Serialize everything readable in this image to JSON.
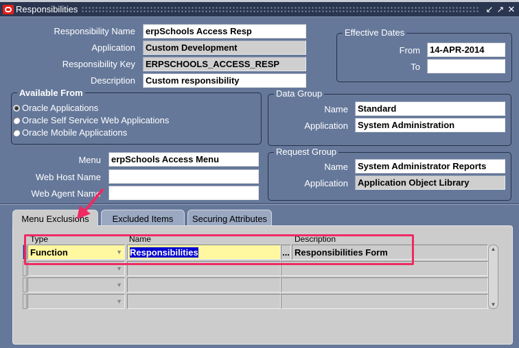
{
  "window": {
    "title": "Responsibilities",
    "controls": [
      "minimize-icon",
      "maximize-icon",
      "close-icon"
    ]
  },
  "header": {
    "responsibility_name": {
      "label": "Responsibility Name",
      "value": "erpSchools Access Resp"
    },
    "application": {
      "label": "Application",
      "value": "Custom Development"
    },
    "responsibility_key": {
      "label": "Responsibility Key",
      "value": "ERPSCHOOLS_ACCESS_RESP"
    },
    "description": {
      "label": "Description",
      "value": "Custom responsibility"
    }
  },
  "effective_dates": {
    "title": "Effective Dates",
    "from_label": "From",
    "from_value": "14-APR-2014",
    "to_label": "To",
    "to_value": ""
  },
  "available_from": {
    "title": "Available From",
    "options": [
      {
        "label": "Oracle Applications",
        "selected": true
      },
      {
        "label": "Oracle Self Service Web Applications",
        "selected": false
      },
      {
        "label": "Oracle Mobile Applications",
        "selected": false
      }
    ]
  },
  "data_group": {
    "title": "Data Group",
    "name_label": "Name",
    "name_value": "Standard",
    "app_label": "Application",
    "app_value": "System Administration"
  },
  "menu": {
    "label": "Menu",
    "value": "erpSchools Access Menu",
    "web_host_label": "Web Host Name",
    "web_host_value": "",
    "web_agent_label": "Web Agent Name",
    "web_agent_value": ""
  },
  "request_group": {
    "title": "Request Group",
    "name_label": "Name",
    "name_value": "System Administrator Reports",
    "app_label": "Application",
    "app_value": "Application Object Library"
  },
  "tabs": [
    {
      "label": "Menu Exclusions",
      "active": true
    },
    {
      "label": "Excluded Items",
      "active": false
    },
    {
      "label": "Securing Attributes",
      "active": false
    }
  ],
  "grid": {
    "columns": [
      "Type",
      "Name",
      "Description"
    ],
    "rows": [
      {
        "type": "Function",
        "name": "Responsibilities",
        "description": "Responsibilities Form"
      },
      {
        "type": "",
        "name": "",
        "description": ""
      },
      {
        "type": "",
        "name": "",
        "description": ""
      },
      {
        "type": "",
        "name": "",
        "description": ""
      }
    ],
    "lov_label": "..."
  },
  "annotation": {
    "highlight_color": "#ee2a62"
  }
}
